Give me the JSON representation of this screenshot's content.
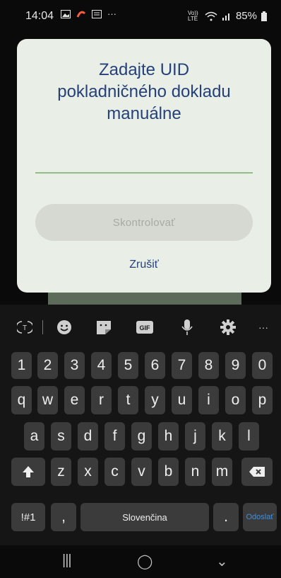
{
  "status": {
    "time": "14:04",
    "network": "Vo)) LTE",
    "battery": "85%"
  },
  "dialog": {
    "title_lines": [
      "Zadajte UID",
      "pokladničného dokladu",
      "manuálne"
    ],
    "input_value": "",
    "check_label": "Skontrolovať",
    "cancel_label": "Zrušiť"
  },
  "keyboard": {
    "toolbar": [
      "translate-icon",
      "emoji-icon",
      "sticker-icon",
      "gif-icon",
      "mic-icon",
      "settings-icon",
      "more-icon"
    ],
    "gif_label": "GIF",
    "more_label": "···",
    "numbers": [
      "1",
      "2",
      "3",
      "4",
      "5",
      "6",
      "7",
      "8",
      "9",
      "0"
    ],
    "row1": [
      "q",
      "w",
      "e",
      "r",
      "t",
      "y",
      "u",
      "i",
      "o",
      "p"
    ],
    "row2": [
      "a",
      "s",
      "d",
      "f",
      "g",
      "h",
      "j",
      "k",
      "l"
    ],
    "row3": [
      "z",
      "x",
      "c",
      "v",
      "b",
      "n",
      "m"
    ],
    "symbols_label": "!#1",
    "comma_label": ",",
    "space_label": "Slovenčina",
    "period_label": ".",
    "send_label": "Odoslať",
    "send_color": "#3d8fe0"
  },
  "navbar": {
    "recent": "|||",
    "home": "◯",
    "back": "⌄"
  }
}
